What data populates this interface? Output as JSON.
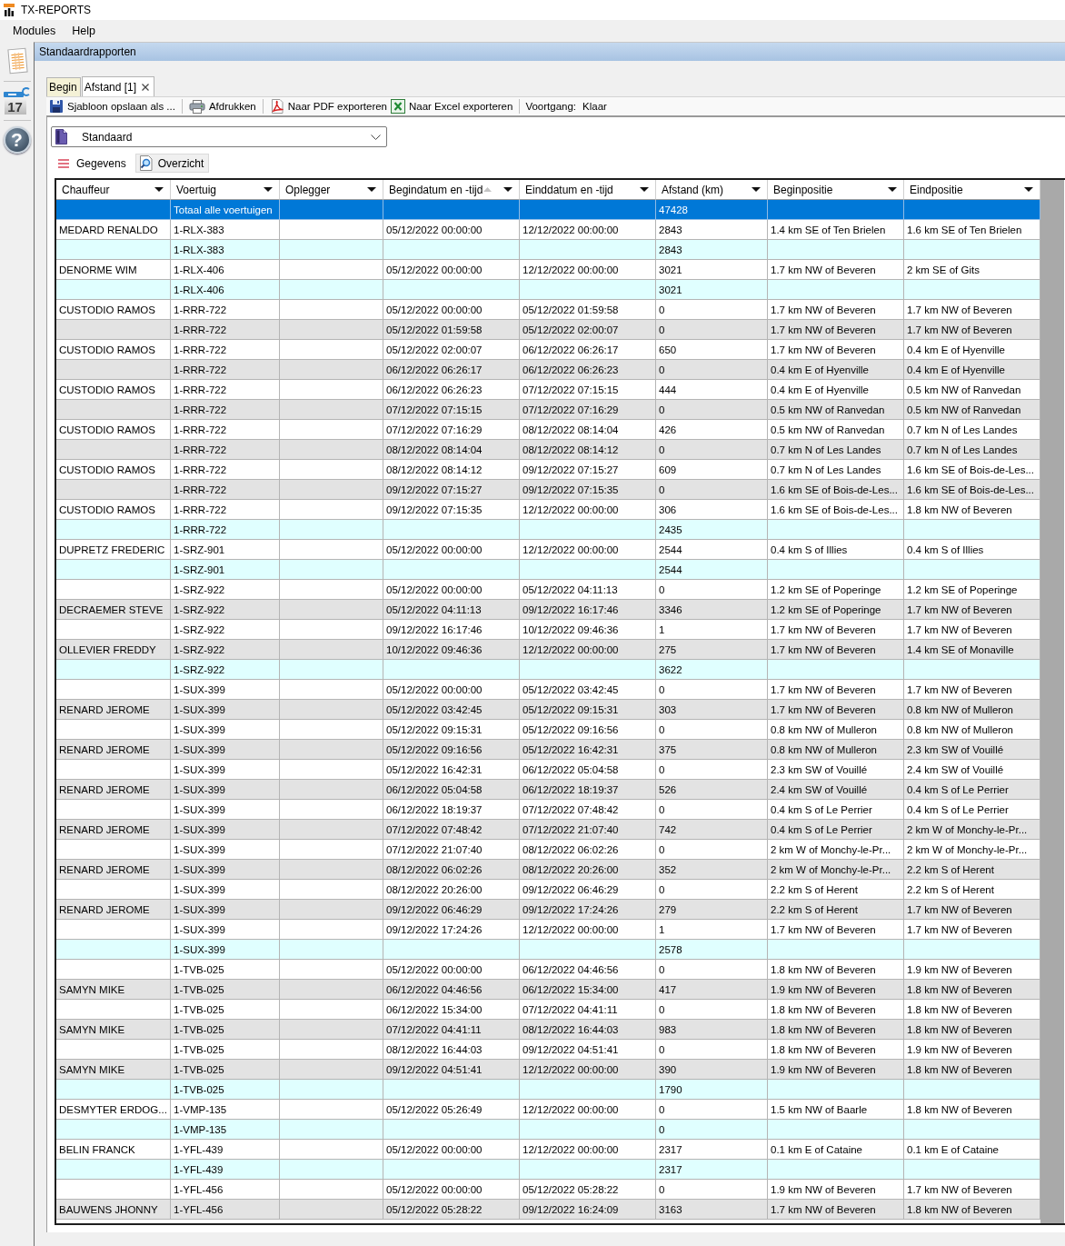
{
  "window": {
    "title": "TX-REPORTS"
  },
  "menu": [
    "Modules",
    "Help"
  ],
  "sidebar": {
    "items": [
      {
        "kind": "report"
      },
      {
        "kind": "calendar",
        "text": "17"
      },
      {
        "kind": "help",
        "text": "?"
      }
    ]
  },
  "panel": {
    "title": "Standaardrapporten"
  },
  "tabs": [
    {
      "label": "Begin",
      "selected": false,
      "closable": false
    },
    {
      "label": "Afstand [1]",
      "selected": true,
      "closable": true
    }
  ],
  "toolbar": {
    "buttons": [
      "Sjabloon opslaan als ...",
      "Afdrukken",
      "Naar PDF exporteren",
      "Naar Excel exporteren"
    ],
    "progress_label": "Voortgang:",
    "progress_value": "Klaar"
  },
  "template_select": {
    "value": "Standaard"
  },
  "view_tabs": [
    {
      "label": "Gegevens",
      "selected": true
    },
    {
      "label": "Overzicht",
      "selected": false
    }
  ],
  "table": {
    "columns": [
      {
        "label": "Chauffeur",
        "sorted": false
      },
      {
        "label": "Voertuig",
        "sorted": false
      },
      {
        "label": "Oplegger",
        "sorted": false
      },
      {
        "label": "Begindatum en -tijd",
        "sorted": true
      },
      {
        "label": "Einddatum en -tijd",
        "sorted": false
      },
      {
        "label": "Afstand (km)",
        "sorted": false
      },
      {
        "label": "Beginpositie",
        "sorted": false
      },
      {
        "label": "Eindpositie",
        "sorted": false
      }
    ],
    "rows": [
      {
        "kind": "summary",
        "selected": true,
        "voertuig": "Totaal alle voertuigen",
        "afstand": "47428"
      },
      {
        "kind": "detail",
        "selected": false,
        "chauffeur": "MEDARD RENALDO",
        "voertuig": "1-RLX-383",
        "begindatum": "05/12/2022 00:00:00",
        "einddatum": "12/12/2022 00:00:00",
        "afstand": "2843",
        "beginpositie": "1.4 km SE of Ten Brielen",
        "eindpositie": "1.6 km SE of Ten Brielen"
      },
      {
        "kind": "summary",
        "selected": false,
        "voertuig": "1-RLX-383",
        "afstand": "2843"
      },
      {
        "kind": "detail",
        "selected": false,
        "chauffeur": "DENORME WIM",
        "voertuig": "1-RLX-406",
        "begindatum": "05/12/2022 00:00:00",
        "einddatum": "12/12/2022 00:00:00",
        "afstand": "3021",
        "beginpositie": "1.7 km NW of Beveren",
        "eindpositie": "2 km SE of Gits"
      },
      {
        "kind": "summary",
        "selected": false,
        "voertuig": "1-RLX-406",
        "afstand": "3021"
      },
      {
        "kind": "detail",
        "selected": false,
        "chauffeur": "CUSTODIO RAMOS",
        "voertuig": "1-RRR-722",
        "begindatum": "05/12/2022 00:00:00",
        "einddatum": "05/12/2022 01:59:58",
        "afstand": "0",
        "beginpositie": "1.7 km NW of Beveren",
        "eindpositie": "1.7 km NW of Beveren"
      },
      {
        "kind": "detail",
        "selected": false,
        "voertuig": "1-RRR-722",
        "begindatum": "05/12/2022 01:59:58",
        "einddatum": "05/12/2022 02:00:07",
        "afstand": "0",
        "beginpositie": "1.7 km NW of Beveren",
        "eindpositie": "1.7 km NW of Beveren"
      },
      {
        "kind": "detail",
        "selected": false,
        "chauffeur": "CUSTODIO RAMOS",
        "voertuig": "1-RRR-722",
        "begindatum": "05/12/2022 02:00:07",
        "einddatum": "06/12/2022 06:26:17",
        "afstand": "650",
        "beginpositie": "1.7 km NW of Beveren",
        "eindpositie": "0.4 km E of Hyenville"
      },
      {
        "kind": "detail",
        "selected": false,
        "voertuig": "1-RRR-722",
        "begindatum": "06/12/2022 06:26:17",
        "einddatum": "06/12/2022 06:26:23",
        "afstand": "0",
        "beginpositie": "0.4 km E of Hyenville",
        "eindpositie": "0.4 km E of Hyenville"
      },
      {
        "kind": "detail",
        "selected": false,
        "chauffeur": "CUSTODIO RAMOS",
        "voertuig": "1-RRR-722",
        "begindatum": "06/12/2022 06:26:23",
        "einddatum": "07/12/2022 07:15:15",
        "afstand": "444",
        "beginpositie": "0.4 km E of Hyenville",
        "eindpositie": "0.5 km NW of Ranvedan"
      },
      {
        "kind": "detail",
        "selected": false,
        "voertuig": "1-RRR-722",
        "begindatum": "07/12/2022 07:15:15",
        "einddatum": "07/12/2022 07:16:29",
        "afstand": "0",
        "beginpositie": "0.5 km NW of Ranvedan",
        "eindpositie": "0.5 km NW of Ranvedan"
      },
      {
        "kind": "detail",
        "selected": false,
        "chauffeur": "CUSTODIO RAMOS",
        "voertuig": "1-RRR-722",
        "begindatum": "07/12/2022 07:16:29",
        "einddatum": "08/12/2022 08:14:04",
        "afstand": "426",
        "beginpositie": "0.5 km NW of Ranvedan",
        "eindpositie": "0.7 km N of Les Landes"
      },
      {
        "kind": "detail",
        "selected": false,
        "voertuig": "1-RRR-722",
        "begindatum": "08/12/2022 08:14:04",
        "einddatum": "08/12/2022 08:14:12",
        "afstand": "0",
        "beginpositie": "0.7 km N of Les Landes",
        "eindpositie": "0.7 km N of Les Landes"
      },
      {
        "kind": "detail",
        "selected": false,
        "chauffeur": "CUSTODIO RAMOS",
        "voertuig": "1-RRR-722",
        "begindatum": "08/12/2022 08:14:12",
        "einddatum": "09/12/2022 07:15:27",
        "afstand": "609",
        "beginpositie": "0.7 km N of Les Landes",
        "eindpositie": "1.6 km SE of Bois-de-Les..."
      },
      {
        "kind": "detail",
        "selected": false,
        "voertuig": "1-RRR-722",
        "begindatum": "09/12/2022 07:15:27",
        "einddatum": "09/12/2022 07:15:35",
        "afstand": "0",
        "beginpositie": "1.6 km SE of Bois-de-Les...",
        "eindpositie": "1.6 km SE of Bois-de-Les..."
      },
      {
        "kind": "detail",
        "selected": false,
        "chauffeur": "CUSTODIO RAMOS",
        "voertuig": "1-RRR-722",
        "begindatum": "09/12/2022 07:15:35",
        "einddatum": "12/12/2022 00:00:00",
        "afstand": "306",
        "beginpositie": "1.6 km SE of Bois-de-Les...",
        "eindpositie": "1.8 km NW of Beveren"
      },
      {
        "kind": "summary",
        "selected": false,
        "voertuig": "1-RRR-722",
        "afstand": "2435"
      },
      {
        "kind": "detail",
        "selected": false,
        "chauffeur": "DUPRETZ FREDERIC",
        "voertuig": "1-SRZ-901",
        "begindatum": "05/12/2022 00:00:00",
        "einddatum": "12/12/2022 00:00:00",
        "afstand": "2544",
        "beginpositie": "0.4 km S of Illies",
        "eindpositie": "0.4 km S of Illies"
      },
      {
        "kind": "summary",
        "selected": false,
        "voertuig": "1-SRZ-901",
        "afstand": "2544"
      },
      {
        "kind": "detail",
        "selected": false,
        "voertuig": "1-SRZ-922",
        "begindatum": "05/12/2022 00:00:00",
        "einddatum": "05/12/2022 04:11:13",
        "afstand": "0",
        "beginpositie": "1.2 km SE of Poperinge",
        "eindpositie": "1.2 km SE of Poperinge"
      },
      {
        "kind": "detail",
        "selected": false,
        "chauffeur": "DECRAEMER STEVE",
        "voertuig": "1-SRZ-922",
        "begindatum": "05/12/2022 04:11:13",
        "einddatum": "09/12/2022 16:17:46",
        "afstand": "3346",
        "beginpositie": "1.2 km SE of Poperinge",
        "eindpositie": "1.7 km NW of Beveren"
      },
      {
        "kind": "detail",
        "selected": false,
        "voertuig": "1-SRZ-922",
        "begindatum": "09/12/2022 16:17:46",
        "einddatum": "10/12/2022 09:46:36",
        "afstand": "1",
        "beginpositie": "1.7 km NW of Beveren",
        "eindpositie": "1.7 km NW of Beveren"
      },
      {
        "kind": "detail",
        "selected": false,
        "chauffeur": "OLLEVIER FREDDY",
        "voertuig": "1-SRZ-922",
        "begindatum": "10/12/2022 09:46:36",
        "einddatum": "12/12/2022 00:00:00",
        "afstand": "275",
        "beginpositie": "1.7 km NW of Beveren",
        "eindpositie": "1.4 km SE of Monaville"
      },
      {
        "kind": "summary",
        "selected": false,
        "voertuig": "1-SRZ-922",
        "afstand": "3622"
      },
      {
        "kind": "detail",
        "selected": false,
        "voertuig": "1-SUX-399",
        "begindatum": "05/12/2022 00:00:00",
        "einddatum": "05/12/2022 03:42:45",
        "afstand": "0",
        "beginpositie": "1.7 km NW of Beveren",
        "eindpositie": "1.7 km NW of Beveren"
      },
      {
        "kind": "detail",
        "selected": false,
        "chauffeur": "RENARD JEROME",
        "voertuig": "1-SUX-399",
        "begindatum": "05/12/2022 03:42:45",
        "einddatum": "05/12/2022 09:15:31",
        "afstand": "303",
        "beginpositie": "1.7 km NW of Beveren",
        "eindpositie": "0.8 km NW of Mulleron"
      },
      {
        "kind": "detail",
        "selected": false,
        "voertuig": "1-SUX-399",
        "begindatum": "05/12/2022 09:15:31",
        "einddatum": "05/12/2022 09:16:56",
        "afstand": "0",
        "beginpositie": "0.8 km NW of Mulleron",
        "eindpositie": "0.8 km NW of Mulleron"
      },
      {
        "kind": "detail",
        "selected": false,
        "chauffeur": "RENARD JEROME",
        "voertuig": "1-SUX-399",
        "begindatum": "05/12/2022 09:16:56",
        "einddatum": "05/12/2022 16:42:31",
        "afstand": "375",
        "beginpositie": "0.8 km NW of Mulleron",
        "eindpositie": "2.3 km SW of Vouillé"
      },
      {
        "kind": "detail",
        "selected": false,
        "voertuig": "1-SUX-399",
        "begindatum": "05/12/2022 16:42:31",
        "einddatum": "06/12/2022 05:04:58",
        "afstand": "0",
        "beginpositie": "2.3 km SW of Vouillé",
        "eindpositie": "2.4 km SW of Vouillé"
      },
      {
        "kind": "detail",
        "selected": false,
        "chauffeur": "RENARD JEROME",
        "voertuig": "1-SUX-399",
        "begindatum": "06/12/2022 05:04:58",
        "einddatum": "06/12/2022 18:19:37",
        "afstand": "526",
        "beginpositie": "2.4 km SW of Vouillé",
        "eindpositie": "0.4 km S of Le Perrier"
      },
      {
        "kind": "detail",
        "selected": false,
        "voertuig": "1-SUX-399",
        "begindatum": "06/12/2022 18:19:37",
        "einddatum": "07/12/2022 07:48:42",
        "afstand": "0",
        "beginpositie": "0.4 km S of Le Perrier",
        "eindpositie": "0.4 km S of Le Perrier"
      },
      {
        "kind": "detail",
        "selected": false,
        "chauffeur": "RENARD JEROME",
        "voertuig": "1-SUX-399",
        "begindatum": "07/12/2022 07:48:42",
        "einddatum": "07/12/2022 21:07:40",
        "afstand": "742",
        "beginpositie": "0.4 km S of Le Perrier",
        "eindpositie": "2 km W of Monchy-le-Pr..."
      },
      {
        "kind": "detail",
        "selected": false,
        "voertuig": "1-SUX-399",
        "begindatum": "07/12/2022 21:07:40",
        "einddatum": "08/12/2022 06:02:26",
        "afstand": "0",
        "beginpositie": "2 km W of Monchy-le-Pr...",
        "eindpositie": "2 km W of Monchy-le-Pr..."
      },
      {
        "kind": "detail",
        "selected": false,
        "chauffeur": "RENARD JEROME",
        "voertuig": "1-SUX-399",
        "begindatum": "08/12/2022 06:02:26",
        "einddatum": "08/12/2022 20:26:00",
        "afstand": "352",
        "beginpositie": "2 km W of Monchy-le-Pr...",
        "eindpositie": "2.2 km S of Herent"
      },
      {
        "kind": "detail",
        "selected": false,
        "voertuig": "1-SUX-399",
        "begindatum": "08/12/2022 20:26:00",
        "einddatum": "09/12/2022 06:46:29",
        "afstand": "0",
        "beginpositie": "2.2 km S of Herent",
        "eindpositie": "2.2 km S of Herent"
      },
      {
        "kind": "detail",
        "selected": false,
        "chauffeur": "RENARD JEROME",
        "voertuig": "1-SUX-399",
        "begindatum": "09/12/2022 06:46:29",
        "einddatum": "09/12/2022 17:24:26",
        "afstand": "279",
        "beginpositie": "2.2 km S of Herent",
        "eindpositie": "1.7 km NW of Beveren"
      },
      {
        "kind": "detail",
        "selected": false,
        "voertuig": "1-SUX-399",
        "begindatum": "09/12/2022 17:24:26",
        "einddatum": "12/12/2022 00:00:00",
        "afstand": "1",
        "beginpositie": "1.7 km NW of Beveren",
        "eindpositie": "1.7 km NW of Beveren"
      },
      {
        "kind": "summary",
        "selected": false,
        "voertuig": "1-SUX-399",
        "afstand": "2578"
      },
      {
        "kind": "detail",
        "selected": false,
        "voertuig": "1-TVB-025",
        "begindatum": "05/12/2022 00:00:00",
        "einddatum": "06/12/2022 04:46:56",
        "afstand": "0",
        "beginpositie": "1.8 km NW of Beveren",
        "eindpositie": "1.9 km NW of Beveren"
      },
      {
        "kind": "detail",
        "selected": false,
        "chauffeur": "SAMYN MIKE",
        "voertuig": "1-TVB-025",
        "begindatum": "06/12/2022 04:46:56",
        "einddatum": "06/12/2022 15:34:00",
        "afstand": "417",
        "beginpositie": "1.9 km NW of Beveren",
        "eindpositie": "1.8 km NW of Beveren"
      },
      {
        "kind": "detail",
        "selected": false,
        "voertuig": "1-TVB-025",
        "begindatum": "06/12/2022 15:34:00",
        "einddatum": "07/12/2022 04:41:11",
        "afstand": "0",
        "beginpositie": "1.8 km NW of Beveren",
        "eindpositie": "1.8 km NW of Beveren"
      },
      {
        "kind": "detail",
        "selected": false,
        "chauffeur": "SAMYN MIKE",
        "voertuig": "1-TVB-025",
        "begindatum": "07/12/2022 04:41:11",
        "einddatum": "08/12/2022 16:44:03",
        "afstand": "983",
        "beginpositie": "1.8 km NW of Beveren",
        "eindpositie": "1.8 km NW of Beveren"
      },
      {
        "kind": "detail",
        "selected": false,
        "voertuig": "1-TVB-025",
        "begindatum": "08/12/2022 16:44:03",
        "einddatum": "09/12/2022 04:51:41",
        "afstand": "0",
        "beginpositie": "1.8 km NW of Beveren",
        "eindpositie": "1.9 km NW of Beveren"
      },
      {
        "kind": "detail",
        "selected": false,
        "chauffeur": "SAMYN MIKE",
        "voertuig": "1-TVB-025",
        "begindatum": "09/12/2022 04:51:41",
        "einddatum": "12/12/2022 00:00:00",
        "afstand": "390",
        "beginpositie": "1.9 km NW of Beveren",
        "eindpositie": "1.8 km NW of Beveren"
      },
      {
        "kind": "summary",
        "selected": false,
        "voertuig": "1-TVB-025",
        "afstand": "1790"
      },
      {
        "kind": "detail",
        "selected": false,
        "chauffeur": "DESMYTER ERDOG...",
        "voertuig": "1-VMP-135",
        "begindatum": "05/12/2022 05:26:49",
        "einddatum": "12/12/2022 00:00:00",
        "afstand": "0",
        "beginpositie": "1.5 km NW of Baarle",
        "eindpositie": "1.8 km NW of Beveren"
      },
      {
        "kind": "summary",
        "selected": false,
        "voertuig": "1-VMP-135",
        "afstand": "0"
      },
      {
        "kind": "detail",
        "selected": false,
        "chauffeur": "BELIN FRANCK",
        "voertuig": "1-YFL-439",
        "begindatum": "05/12/2022 00:00:00",
        "einddatum": "12/12/2022 00:00:00",
        "afstand": "2317",
        "beginpositie": "0.1 km E of Cataine",
        "eindpositie": "0.1 km E of Cataine"
      },
      {
        "kind": "summary",
        "selected": false,
        "voertuig": "1-YFL-439",
        "afstand": "2317"
      },
      {
        "kind": "detail",
        "selected": false,
        "voertuig": "1-YFL-456",
        "begindatum": "05/12/2022 00:00:00",
        "einddatum": "05/12/2022 05:28:22",
        "afstand": "0",
        "beginpositie": "1.9 km NW of Beveren",
        "eindpositie": "1.7 km NW of Beveren"
      },
      {
        "kind": "detail",
        "selected": false,
        "chauffeur": "BAUWENS JHONNY",
        "voertuig": "1-YFL-456",
        "begindatum": "05/12/2022 05:28:22",
        "einddatum": "09/12/2022 16:24:09",
        "afstand": "3163",
        "beginpositie": "1.7 km NW of Beveren",
        "eindpositie": "1.8 km NW of Beveren"
      }
    ]
  }
}
